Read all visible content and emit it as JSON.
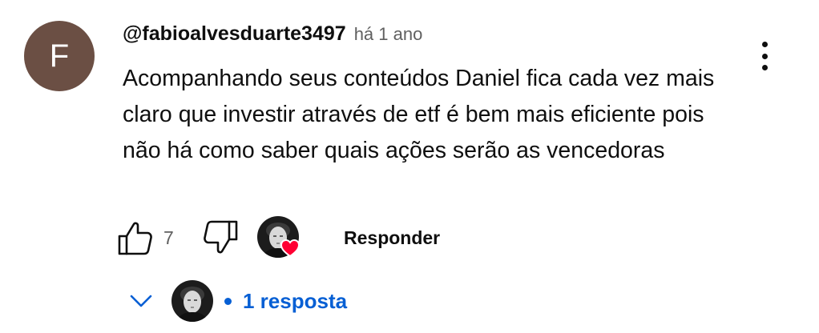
{
  "comment": {
    "avatar_letter": "F",
    "avatar_color": "#6b4f44",
    "author": "@fabioalvesduarte3497",
    "time": "há 1 ano",
    "text": "Acompanhando seus conteúdos Daniel fica cada vez mais claro que investir através de etf é bem mais eficiente pois não há como saber quais ações serão as vencedoras",
    "like_count": "7",
    "reply_label": "Responder",
    "heart_color": "#ff0033"
  },
  "replies": {
    "label": "1 resposta",
    "link_color": "#065fd4"
  },
  "icons": {
    "menu": "more-vertical-icon",
    "like": "thumbs-up-icon",
    "dislike": "thumbs-down-icon",
    "heart": "heart-icon",
    "expand": "chevron-down-icon"
  }
}
